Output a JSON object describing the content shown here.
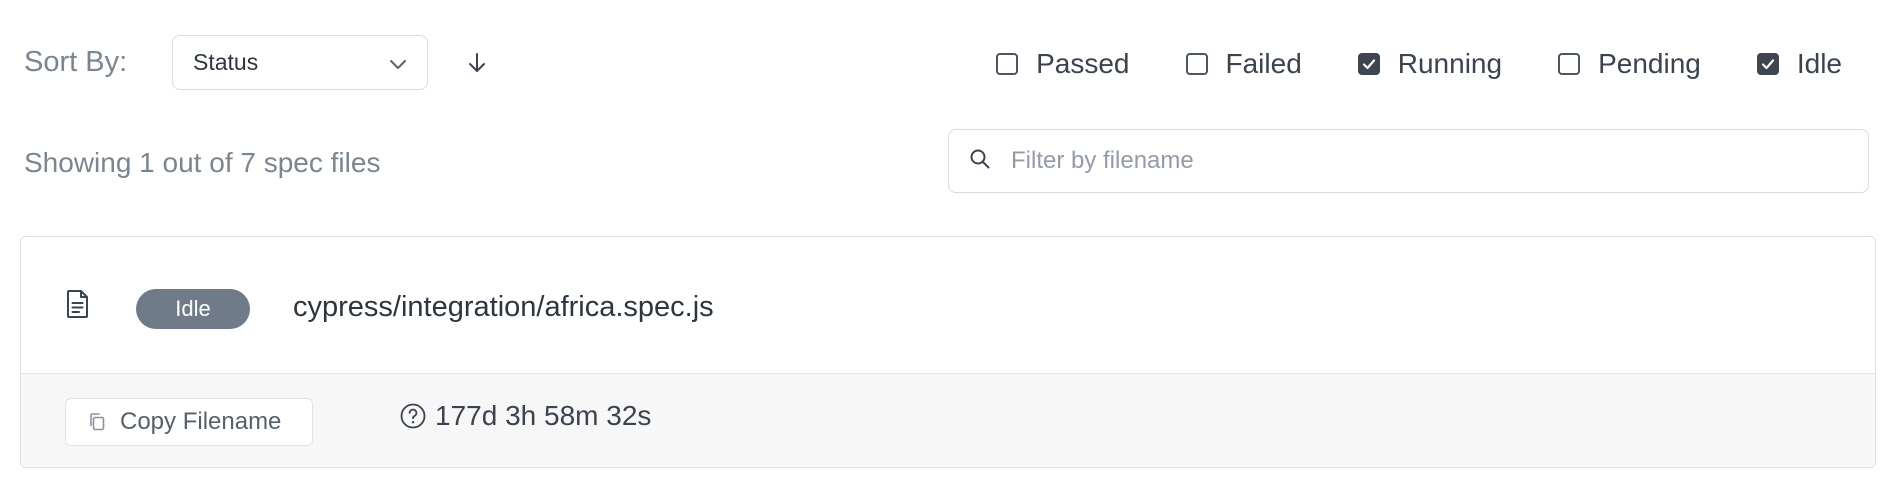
{
  "toolbar": {
    "sort_label": "Sort By:",
    "sort_value": "Status",
    "filters": [
      {
        "label": "Passed",
        "checked": false
      },
      {
        "label": "Failed",
        "checked": false
      },
      {
        "label": "Running",
        "checked": true
      },
      {
        "label": "Pending",
        "checked": false
      },
      {
        "label": "Idle",
        "checked": true
      }
    ]
  },
  "summary": {
    "showing_text": "Showing 1 out of 7 spec files"
  },
  "search": {
    "placeholder": "Filter by filename",
    "value": ""
  },
  "spec": {
    "status": "Idle",
    "path": "cypress/integration/africa.spec.js",
    "copy_label": "Copy Filename",
    "duration": "177d 3h 58m 32s"
  },
  "icons": {
    "file": "file-text-icon",
    "search": "search-icon",
    "sort": "arrow-down-icon",
    "copy": "copy-icon",
    "duration": "question-circle-icon",
    "dropdown": "chevron-down-icon"
  },
  "colors": {
    "idle_badge": "#6f7b88",
    "checkbox_checked": "#3d4650",
    "muted_text": "#7a8592"
  }
}
